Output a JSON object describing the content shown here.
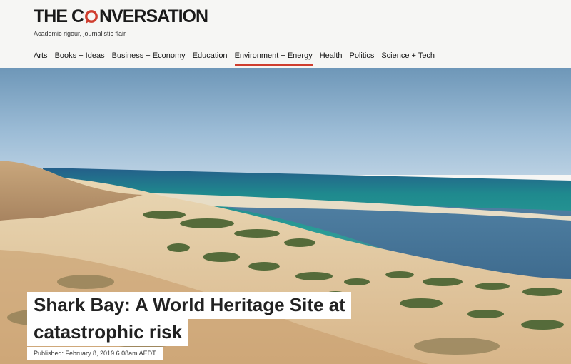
{
  "site": {
    "logo_before": "THE C",
    "logo_after": "NVERSATION",
    "logo_icon": "speech-bubble-icon",
    "brand_color": "#cf3d2e",
    "tagline": "Academic rigour, journalistic flair"
  },
  "nav": {
    "items": [
      {
        "label": "Arts",
        "active": false
      },
      {
        "label": "Books + Ideas",
        "active": false
      },
      {
        "label": "Business + Economy",
        "active": false
      },
      {
        "label": "Education",
        "active": false
      },
      {
        "label": "Environment + Energy",
        "active": true
      },
      {
        "label": "Health",
        "active": false
      },
      {
        "label": "Politics",
        "active": false
      },
      {
        "label": "Science + Tech",
        "active": false
      }
    ]
  },
  "article": {
    "headline_line1": "Shark Bay: A World Heritage Site at",
    "headline_line2": "catastrophic risk",
    "published": "Published: February 8, 2019 6.08am AEDT"
  }
}
